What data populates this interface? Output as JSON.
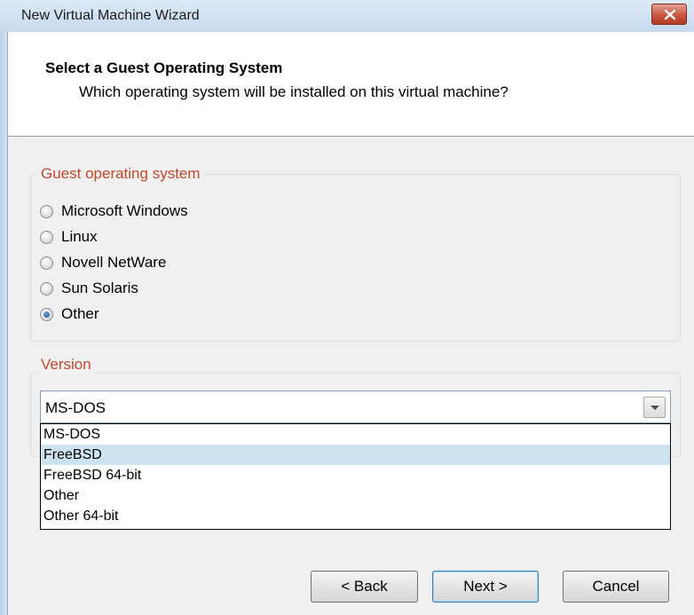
{
  "window": {
    "title": "New Virtual Machine Wizard",
    "close_icon": "close-x-icon",
    "close_color": "#c8563f"
  },
  "header": {
    "title": "Select a Guest Operating System",
    "subtitle": "Which operating system will be installed on this virtual machine?"
  },
  "guest_os": {
    "legend": "Guest operating system",
    "options": [
      {
        "label": "Microsoft Windows",
        "checked": false
      },
      {
        "label": "Linux",
        "checked": false
      },
      {
        "label": "Novell NetWare",
        "checked": false
      },
      {
        "label": "Sun Solaris",
        "checked": false
      },
      {
        "label": "Other",
        "checked": true
      }
    ]
  },
  "version": {
    "legend": "Version",
    "selected": "MS-DOS",
    "options": [
      "MS-DOS",
      "FreeBSD",
      "FreeBSD 64-bit",
      "Other",
      "Other 64-bit"
    ],
    "highlighted": "FreeBSD",
    "highlight_color": "#cde4f0"
  },
  "buttons": {
    "back": "< Back",
    "next": "Next >",
    "cancel": "Cancel"
  },
  "colors": {
    "legend": "#c5482a",
    "background": "#f0f0f0"
  }
}
